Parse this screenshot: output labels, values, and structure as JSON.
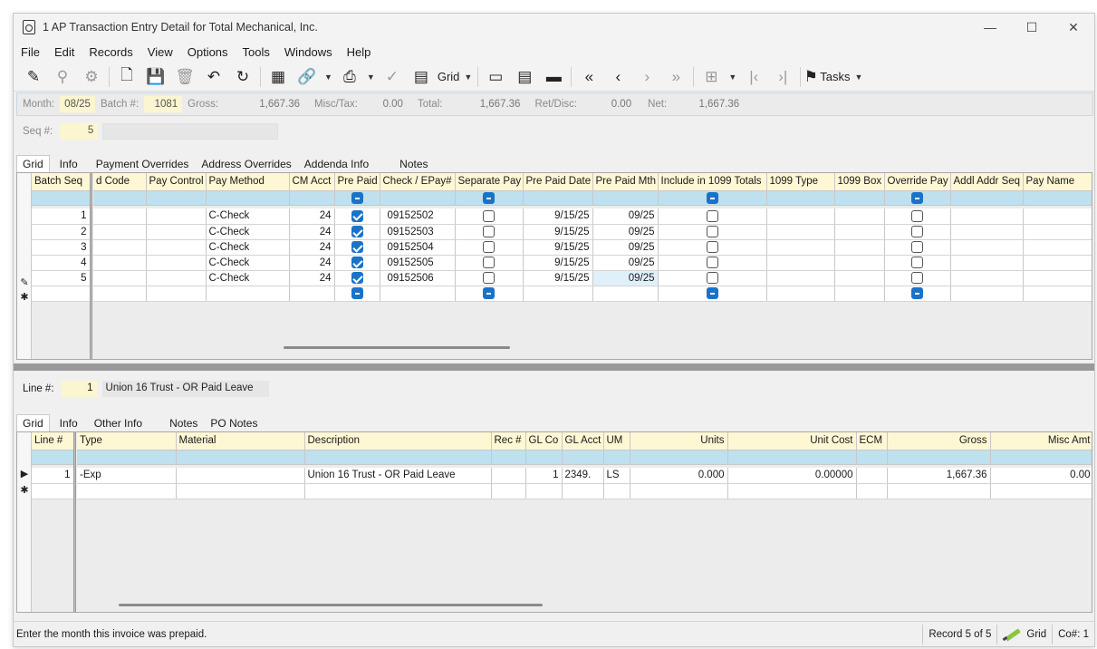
{
  "window": {
    "title": "1 AP Transaction Entry Detail for Total Mechanical, Inc.",
    "minimize": "—",
    "maximize": "☐",
    "close": "✕"
  },
  "menu": [
    "File",
    "Edit",
    "Records",
    "View",
    "Options",
    "Tools",
    "Windows",
    "Help"
  ],
  "toolbar": {
    "grid_label": "Grid",
    "tasks_label": "Tasks"
  },
  "summary": {
    "month_label": "Month:",
    "month": "08/25",
    "batch_label": "Batch #:",
    "batch": "1081",
    "gross_label": "Gross:",
    "gross": "1,667.36",
    "misc_label": "Misc/Tax:",
    "misc": "0.00",
    "total_label": "Total:",
    "total": "1,667.36",
    "ret_label": "Ret/Disc:",
    "ret": "0.00",
    "net_label": "Net:",
    "net": "1,667.36"
  },
  "seq": {
    "label": "Seq #:",
    "value": "5"
  },
  "upper_tabs": [
    "Grid",
    "Info",
    "Payment Overrides",
    "Address Overrides",
    "Addenda Info",
    "Notes"
  ],
  "upper_grid": {
    "columns": [
      "Batch Seq",
      "d Code",
      "Pay Control",
      "Pay Method",
      "CM Acct",
      "Pre Paid",
      "Check / EPay#",
      "Separate Pay",
      "Pre Paid Date",
      "Pre Paid Mth",
      "Include in 1099 Totals",
      "1099 Type",
      "1099 Box",
      "Override Pay",
      "Addl Addr Seq",
      "Pay Name"
    ],
    "rows": [
      {
        "seq": "1",
        "method": "C-Check",
        "cm": "24",
        "prepaid": true,
        "check": "09152502",
        "sep": false,
        "date": "9/15/25",
        "mth": "09/25",
        "inc1099": false,
        "override": false
      },
      {
        "seq": "2",
        "method": "C-Check",
        "cm": "24",
        "prepaid": true,
        "check": "09152503",
        "sep": false,
        "date": "9/15/25",
        "mth": "09/25",
        "inc1099": false,
        "override": false
      },
      {
        "seq": "3",
        "method": "C-Check",
        "cm": "24",
        "prepaid": true,
        "check": "09152504",
        "sep": false,
        "date": "9/15/25",
        "mth": "09/25",
        "inc1099": false,
        "override": false
      },
      {
        "seq": "4",
        "method": "C-Check",
        "cm": "24",
        "prepaid": true,
        "check": "09152505",
        "sep": false,
        "date": "9/15/25",
        "mth": "09/25",
        "inc1099": false,
        "override": false
      },
      {
        "seq": "5",
        "method": "C-Check",
        "cm": "24",
        "prepaid": true,
        "check": "09152506",
        "sep": false,
        "date": "9/15/25",
        "mth": "09/25",
        "inc1099": false,
        "override": false
      }
    ],
    "edit_row_indicator": "✎",
    "new_row_indicator": "✱"
  },
  "line": {
    "label": "Line #:",
    "value": "1",
    "description": "Union 16 Trust - OR Paid Leave"
  },
  "lower_tabs": [
    "Grid",
    "Info",
    "Other Info",
    "Notes",
    "PO Notes"
  ],
  "lower_grid": {
    "columns": [
      "Line #",
      "Type",
      "Material",
      "Description",
      "Rec #",
      "GL Co",
      "GL Acct",
      "UM",
      "Units",
      "Unit Cost",
      "ECM",
      "Gross",
      "Misc Amt"
    ],
    "rows": [
      {
        "line": "1",
        "type": "-Exp",
        "material": "",
        "description": "Union 16 Trust - OR Paid Leave",
        "rec": "",
        "glco": "1",
        "glacct": "2349.",
        "um": "LS",
        "units": "0.000",
        "unitcost": "0.00000",
        "ecm": "",
        "gross": "1,667.36",
        "misc": "0.00"
      }
    ],
    "current_row_indicator": "▶",
    "new_row_indicator": "✱"
  },
  "status": {
    "message": "Enter the month this invoice was prepaid.",
    "record": "Record 5 of 5",
    "mode": "Grid",
    "company": "Co#: 1"
  }
}
